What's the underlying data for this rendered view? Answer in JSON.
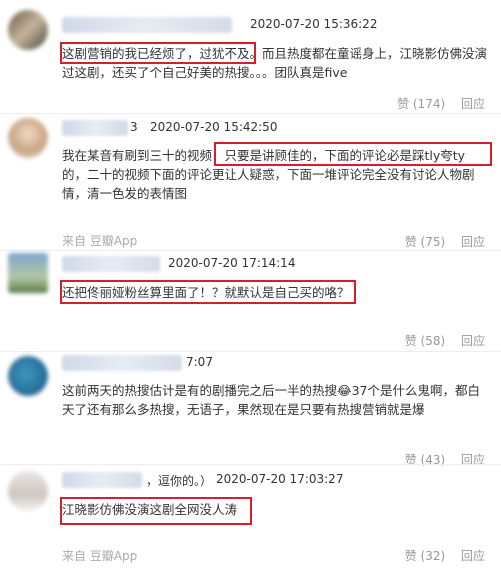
{
  "comments": [
    {
      "user_suffix": "",
      "time": "2020-07-20 15:36:22",
      "text": "这剧营销的我已经烦了，过犹不及。而且热度都在童谣身上，江晓影仿佛没演过这剧，还买了个自己好美的热搜。。。团队真是five",
      "source": "",
      "likes_label": "赞 (174)",
      "reply_label": "回应"
    },
    {
      "user_suffix": "3",
      "time": "2020-07-20 15:42:50",
      "text": "我在某音有刷到三十的视频，只要是讲顾佳的，下面的评论必是踩tly夸ty的，二十的视频下面的评论更让人疑惑，下面一堆评论完全没有讨论人物剧情，清一色发的表情图",
      "source": "来自 豆瓣App",
      "likes_label": "赞 (75)",
      "reply_label": "回应"
    },
    {
      "user_suffix": "",
      "time": "2020-07-20 17:14:14",
      "text": "还把佟丽娅粉丝算里面了！？就默认是自己买的咯？",
      "source": "",
      "likes_label": "赞 (58)",
      "reply_label": "回应"
    },
    {
      "user_suffix": "7:07",
      "time": "",
      "text": "这前两天的热搜估计是有的剧播完之后一半的热搜😂37个是什么鬼啊，都白天了还有那么多热搜，无语子，果然现在是只要有热搜营销就是爆",
      "source": "",
      "likes_label": "赞 (43)",
      "reply_label": "回应"
    },
    {
      "user_suffix": "，逗你的。）",
      "time": "2020-07-20 17:03:27",
      "text": "江晓影仿佛没演这剧全网没人涛",
      "source": "来自 豆瓣App",
      "likes_label": "赞 (32)",
      "reply_label": "回应"
    }
  ],
  "colors": {
    "highlight": "#d81e2a",
    "muted": "#999999"
  }
}
